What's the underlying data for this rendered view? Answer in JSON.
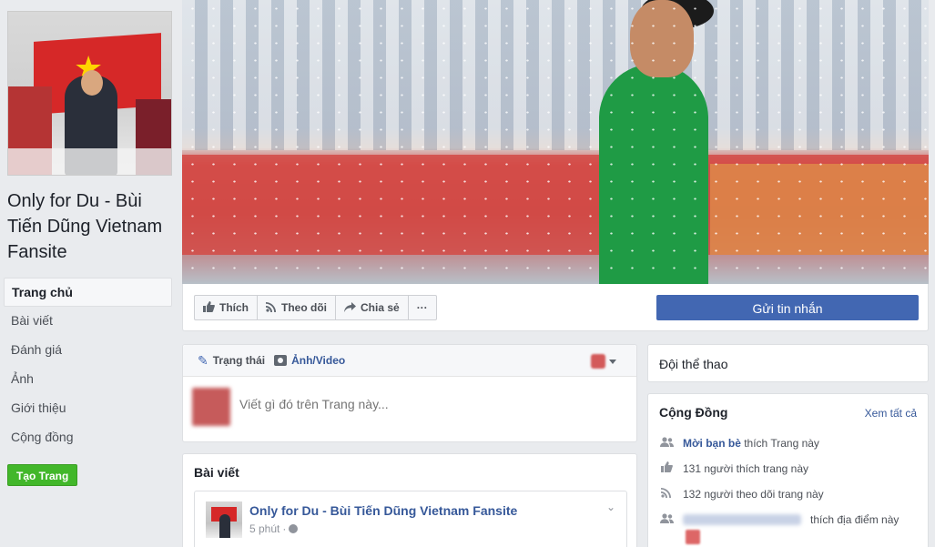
{
  "page": {
    "name": "Only for Du - Bùi Tiến Dũng Vietnam Fansite"
  },
  "nav": {
    "items": [
      {
        "label": "Trang chủ",
        "active": true
      },
      {
        "label": "Bài viết"
      },
      {
        "label": "Đánh giá"
      },
      {
        "label": "Ảnh"
      },
      {
        "label": "Giới thiệu"
      },
      {
        "label": "Cộng đồng"
      }
    ],
    "create_page": "Tạo Trang"
  },
  "actions": {
    "like": "Thích",
    "follow": "Theo dõi",
    "share": "Chia sẻ",
    "more": "···",
    "send_message": "Gửi tin nhắn"
  },
  "composer": {
    "tab_status": "Trạng thái",
    "tab_photo": "Ảnh/Video",
    "placeholder": "Viết gì đó trên Trang này..."
  },
  "posts": {
    "title": "Bài viết",
    "first": {
      "author": "Only for Du - Bùi Tiến Dũng Vietnam Fansite",
      "time": "5 phút",
      "separator": "·"
    }
  },
  "sidebar_right": {
    "category": "Đội thể thao",
    "community": {
      "title": "Cộng Đồng",
      "see_all": "Xem tất cả",
      "invite_link": "Mời bạn bè",
      "invite_suffix": "thích Trang này",
      "likes": "131 người thích trang này",
      "follows": "132 người theo dõi trang này",
      "checkins_suffix": "thích địa điểm này"
    }
  },
  "colors": {
    "brand_blue": "#4267b2",
    "link_blue": "#365899",
    "green": "#42b72a",
    "background": "#e9ebee"
  },
  "icons": {
    "like": "thumbs-up-icon",
    "follow": "rss-icon",
    "share": "share-arrow-icon",
    "status": "pencil-icon",
    "photo": "camera-icon"
  }
}
